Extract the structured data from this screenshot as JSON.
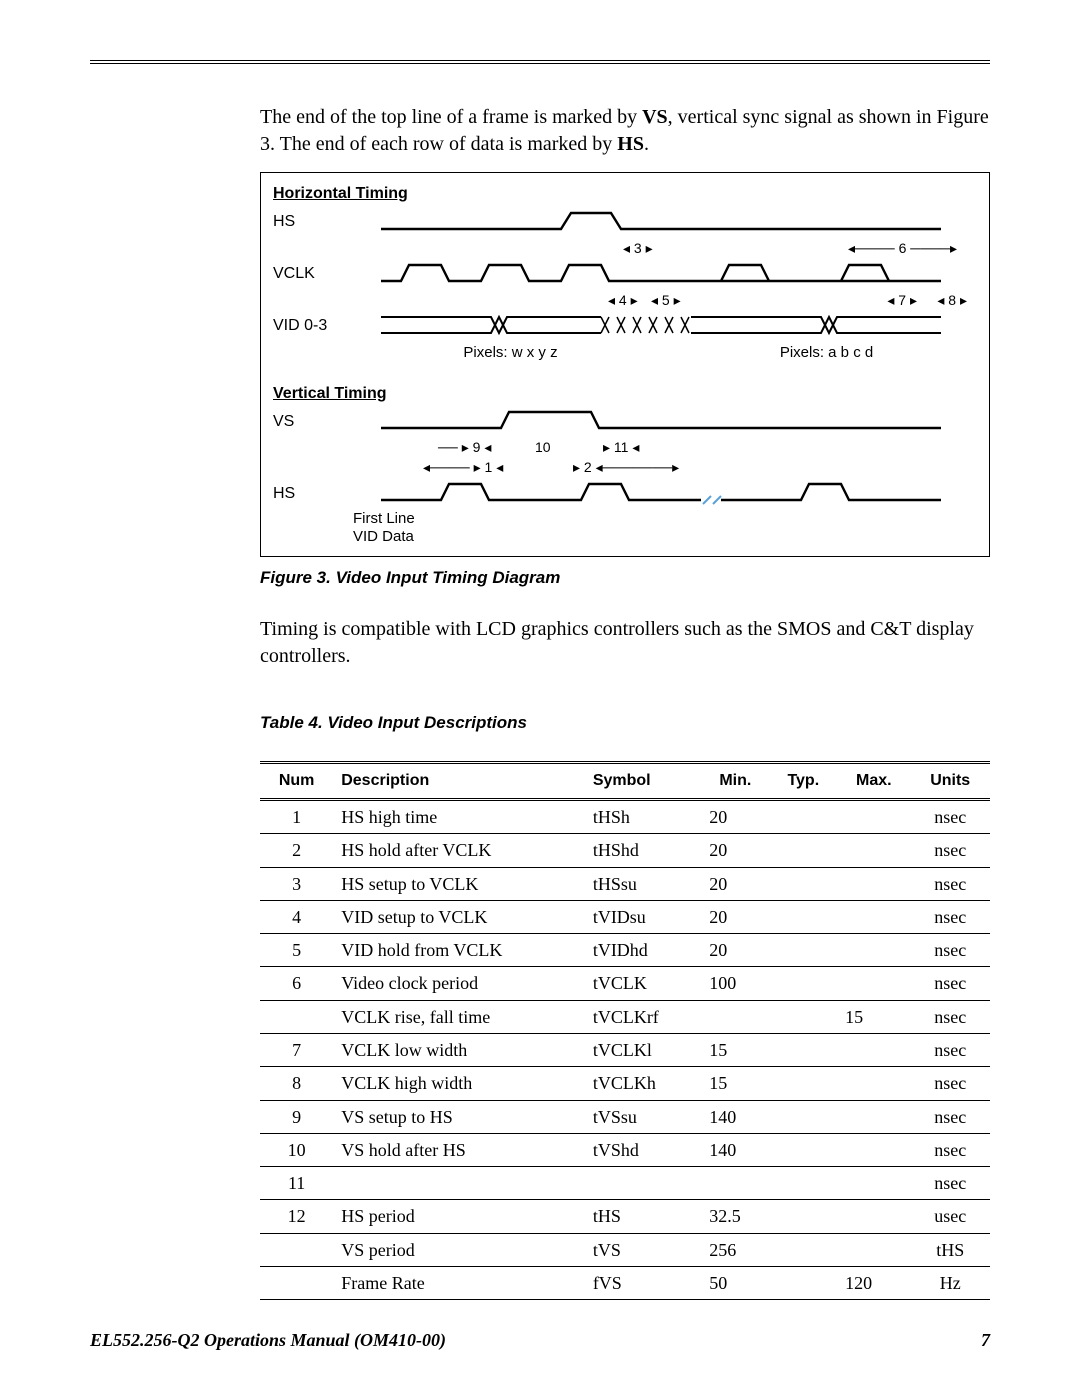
{
  "intro": {
    "p1_a": "The end of the top line of a frame is marked by ",
    "p1_vs": "VS",
    "p1_b": ", vertical sync signal as shown in Figure 3. The end of each row of data is marked by ",
    "p1_hs": "HS",
    "p1_c": "."
  },
  "figure": {
    "h_timing": "Horizontal Timing",
    "hs": "HS",
    "vclk": "VCLK",
    "vid": "VID 0-3",
    "pixels_wxyz": "Pixels: w x y z",
    "pixels_abcd": "Pixels: a b c d",
    "v_timing": "Vertical Timing",
    "vs": "VS",
    "hs2": "HS",
    "first_line": "First Line",
    "vid_data": "VID Data",
    "n1": "1",
    "n2": "2",
    "n3": "3",
    "n4": "4",
    "n5": "5",
    "n6": "6",
    "n7": "7",
    "n8": "8",
    "n9": "9",
    "n10": "10",
    "n11": "11",
    "caption": "Figure 3. Video Input Timing Diagram"
  },
  "para2": "Timing is compatible with LCD graphics controllers such as the SMOS and C&T display controllers.",
  "table": {
    "caption": "Table 4. Video Input Descriptions",
    "headers": {
      "num": "Num",
      "desc": "Description",
      "sym": "Symbol",
      "min": "Min.",
      "typ": "Typ.",
      "max": "Max.",
      "units": "Units"
    },
    "rows": [
      {
        "num": "1",
        "desc": "HS high time",
        "sym": "tHSh",
        "min": "20",
        "typ": "",
        "max": "",
        "units": "nsec"
      },
      {
        "num": "2",
        "desc": "HS hold after VCLK",
        "sym": "tHShd",
        "min": "20",
        "typ": "",
        "max": "",
        "units": "nsec"
      },
      {
        "num": "3",
        "desc": "HS setup to VCLK",
        "sym": "tHSsu",
        "min": "20",
        "typ": "",
        "max": "",
        "units": "nsec"
      },
      {
        "num": "4",
        "desc": "VID setup to VCLK",
        "sym": "tVIDsu",
        "min": "20",
        "typ": "",
        "max": "",
        "units": "nsec"
      },
      {
        "num": "5",
        "desc": "VID hold from VCLK",
        "sym": "tVIDhd",
        "min": "20",
        "typ": "",
        "max": "",
        "units": "nsec"
      },
      {
        "num": "6",
        "desc": "Video clock period",
        "sym": "tVCLK",
        "min": "100",
        "typ": "",
        "max": "",
        "units": "nsec"
      },
      {
        "num": "",
        "desc": "VCLK rise, fall time",
        "sym": "tVCLKrf",
        "min": "",
        "typ": "",
        "max": "15",
        "units": "nsec"
      },
      {
        "num": "7",
        "desc": "VCLK low width",
        "sym": "tVCLKl",
        "min": "15",
        "typ": "",
        "max": "",
        "units": "nsec"
      },
      {
        "num": "8",
        "desc": "VCLK high width",
        "sym": "tVCLKh",
        "min": "15",
        "typ": "",
        "max": "",
        "units": "nsec"
      },
      {
        "num": "9",
        "desc": "VS setup to HS",
        "sym": "tVSsu",
        "min": "140",
        "typ": "",
        "max": "",
        "units": "nsec"
      },
      {
        "num": "10",
        "desc": "VS hold after HS",
        "sym": "tVShd",
        "min": "140",
        "typ": "",
        "max": "",
        "units": "nsec"
      },
      {
        "num": "11",
        "desc": "",
        "sym": "",
        "min": "",
        "typ": "",
        "max": "",
        "units": "nsec"
      },
      {
        "num": "12",
        "desc": "HS period",
        "sym": "tHS",
        "min": "32.5",
        "typ": "",
        "max": "",
        "units": "usec"
      },
      {
        "num": "",
        "desc": "VS period",
        "sym": "tVS",
        "min": "256",
        "typ": "",
        "max": "",
        "units": "tHS"
      },
      {
        "num": "",
        "desc": "Frame Rate",
        "sym": "fVS",
        "min": "50",
        "typ": "",
        "max": "120",
        "units": "Hz"
      }
    ]
  },
  "footer": {
    "doc": "EL552.256-Q2 Operations Manual (OM410-00)",
    "page": "7"
  }
}
